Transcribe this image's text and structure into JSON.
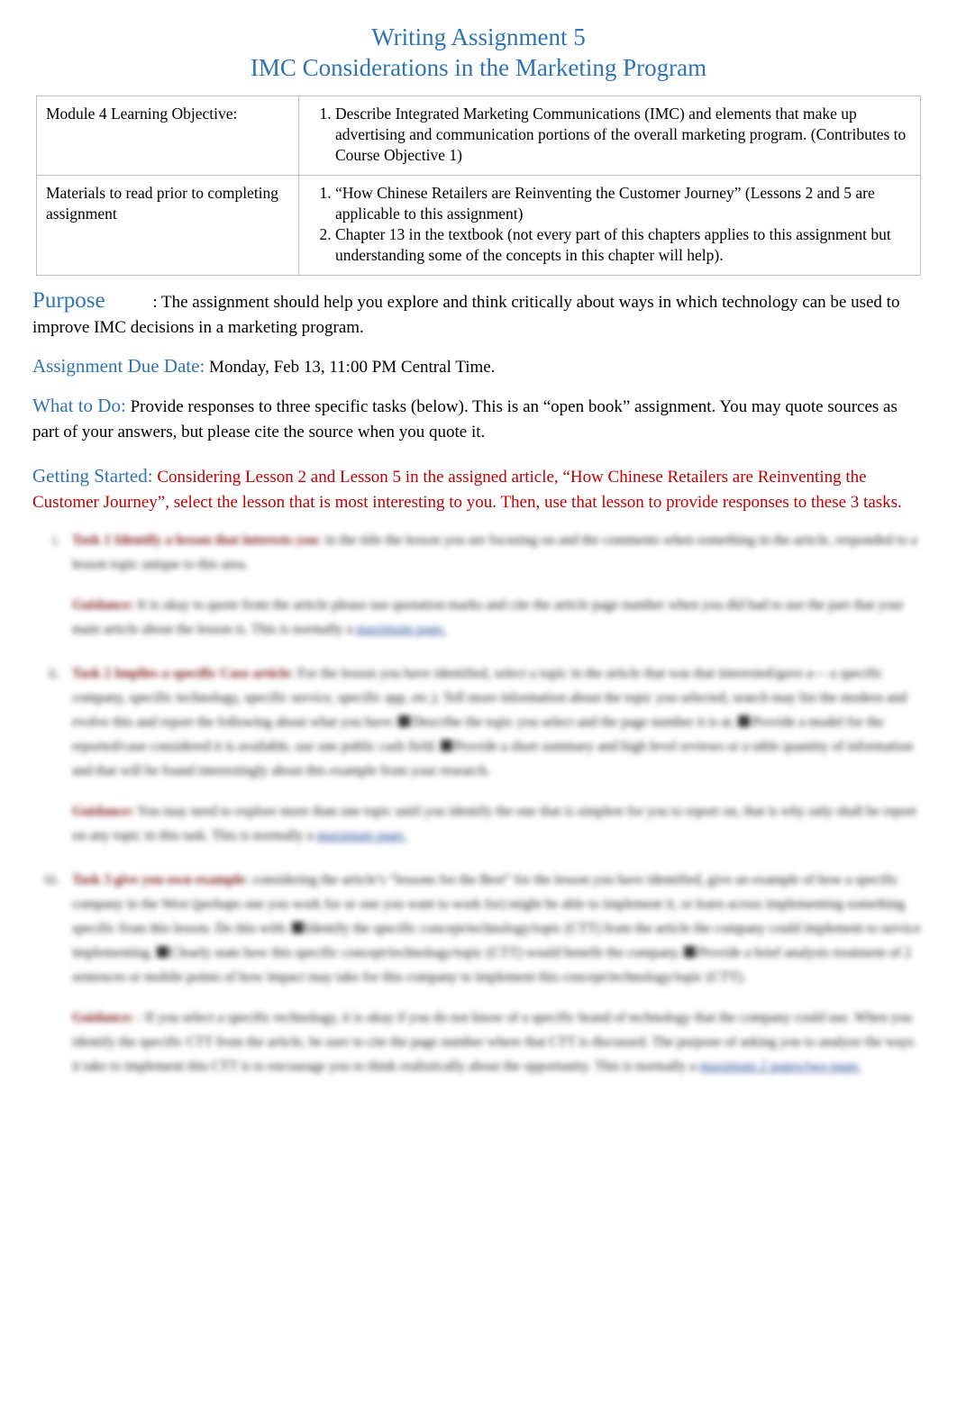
{
  "title": {
    "line1": "Writing Assignment 5",
    "line2": "IMC Considerations in the Marketing Program"
  },
  "info_table": {
    "rows": [
      {
        "label": "Module 4 Learning Objective:",
        "items": [
          "Describe Integrated Marketing Communications (IMC) and elements that make up advertising and communication portions of the overall marketing program. (Contributes to Course Objective 1)"
        ]
      },
      {
        "label": "Materials to read prior to completing assignment",
        "items": [
          "“How Chinese Retailers are Reinventing the Customer Journey” (Lessons 2 and 5 are applicable to this assignment)",
          "Chapter 13 in the textbook (not every part of this chapters applies to this assignment but understanding some of the concepts in this chapter will help)."
        ]
      }
    ]
  },
  "sections": {
    "purpose_heading": "Purpose",
    "purpose_text": ": The assignment should help you explore and think critically about ways in which technology can be used to improve IMC decisions in a marketing program.",
    "due_heading": "Assignment Due Date:",
    "due_text": "Monday, Feb 13, 11:00 PM Central Time.",
    "whattodo_heading": "What to Do:",
    "whattodo_text": "Provide responses to three specific tasks (below). This is an “open book” assignment. You may quote sources as part of your answers, but please cite the source when you quote it.",
    "getting_started_heading": "Getting Started:",
    "getting_started_text": "Considering Lesson 2 and Lesson 5 in the assigned article, “How Chinese Retailers are Reinventing the Customer Journey”, select the lesson that is most interesting to you. Then, use that lesson to provide responses to these 3 tasks."
  },
  "tasks": [
    {
      "number": "i.",
      "title": "Task 1 Identify a lesson that interests you",
      "text": ": in the title the lesson you are focusing on and the comments when something in the article, responded to a lesson topic unique to this area.",
      "guidance_label": "Guidance:",
      "guidance_text": "It is okay to quote from the article please use quotation marks and cite the article page number when you did had to use the part that your main article about the lesson is. This is normally a",
      "guidance_link": "maximum page."
    },
    {
      "number": "ii.",
      "title": "Task 2 Implies a specific Case article",
      "text": ": For the lesson you have identified, select a topic in the article that was that interested/gave a— a specific company, specific technology, specific service, specific app, etc.). Tell more information about the topic you selected, search may list the modern and evolve this and report the following about what you have:",
      "sub1": "Describe the topic you select and the page number it is at.",
      "sub2": "Provide a model for the reported/case considered it is available, use one public cash field.",
      "sub3": "Provide a short summary and high level reviews or a table quantity of information and that will be found interestingly about this example from your research.",
      "guidance_label": "Guidance:",
      "guidance_text": "You may need to explore more than one topic until you identify the one that is simplest for you to report on, that is why only shall be report on any topic in this task. This is normally a",
      "guidance_link": "maximum page."
    },
    {
      "number": "iii.",
      "title": "Task 3 give you own example",
      "text": ": considering the article’s “lessons for the Best” for the lesson you have identified, give an example of how a specific company in the West (perhaps one you work for or one you want to work for) might be able to implement it, or learn across implementing something specific from this lesson. Do this with:",
      "sub1": "Identify the specific concept/technology/topic (CTT) from the article the company could implement to service implementing.",
      "sub2": "Clearly state how this specific concept/technology/topic (CTT) would benefit the company.",
      "sub3": "Provide a brief analysis treatment of 2 sentences or mobile points of how impact may take for this company to implement this concept/technology/topic (CTT).",
      "guidance_label": "Guidance:",
      "guidance_text": ": If you select a specific technology, it is okay if you do not know of a specific brand of technology that the company could use. When you identify the specific CTT from the article, be sure to cite the page number where that CTT is discussed. The purpose of asking you to analyze the ways it take to implement this CTT is to encourage you to think realistically about the opportunity. This is normally a",
      "guidance_link": "maximum 2 pages/two-page."
    }
  ]
}
